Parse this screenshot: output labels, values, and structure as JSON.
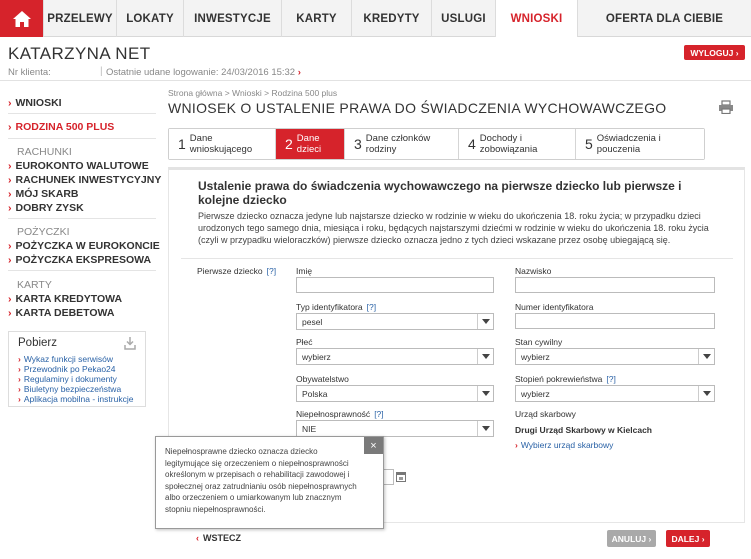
{
  "nav": {
    "items": [
      "PRZELEWY",
      "LOKATY",
      "INWESTYCJE",
      "KARTY",
      "KREDYTY",
      "USLUGI",
      "WNIOSKI",
      "OFERTA DLA CIEBIE"
    ],
    "active": "WNIOSKI"
  },
  "header": {
    "user_name": "KATARZYNA NET",
    "logout_label": "WYLOGUJ",
    "client_label": "Nr klienta:",
    "last_login": "Ostatnie udane logowanie: 24/03/2016 15:32"
  },
  "sidebar": {
    "wnioski": "WNIOSKI",
    "rodzina": "RODZINA 500 PLUS",
    "rachunki_head": "RACHUNKI",
    "rachunki": [
      "EUROKONTO WALUTOWE",
      "RACHUNEK INWESTYCYJNY",
      "MÓJ SKARB",
      "DOBRY ZYSK"
    ],
    "pozyczki_head": "POŻYCZKI",
    "pozyczki": [
      "POŻYCZKA W EUROKONCIE",
      "POŻYCZKA EKSPRESOWA"
    ],
    "karty_head": "KARTY",
    "karty": [
      "KARTA KREDYTOWA",
      "KARTA DEBETOWA"
    ],
    "pobierz_title": "Pobierz",
    "pobierz_links": [
      "Wykaz funkcji serwisów",
      "Przewodnik po Pekao24",
      "Regulaminy i dokumenty",
      "Biuletyny bezpieczeństwa",
      "Aplikacja mobilna - instrukcje"
    ]
  },
  "main": {
    "breadcrumb": "Strona główna > Wnioski > Rodzina 500 plus",
    "title": "WNIOSEK O USTALENIE PRAWA DO ŚWIADCZENIA WYCHOWAWCZEGO",
    "steps": [
      {
        "n": "1",
        "label": "Dane wnioskującego"
      },
      {
        "n": "2",
        "label": "Dane dzieci"
      },
      {
        "n": "3",
        "label": "Dane członków rodziny"
      },
      {
        "n": "4",
        "label": "Dochody i zobowiązania"
      },
      {
        "n": "5",
        "label": "Oświadczenia i pouczenia"
      }
    ],
    "active_step": 2
  },
  "form": {
    "title": "Ustalenie prawa do świadczenia wychowawczego na pierwsze dziecko lub pierwsze i kolejne dziecko",
    "description": "Pierwsze dziecko oznacza jedyne lub najstarsze dziecko w rodzinie w wieku do ukończenia 18. roku życia; w przypadku dzieci urodzonych tego samego dnia, miesiąca i roku, będących najstarszymi dziećmi w rodzinie w wieku do ukończenia 18. roku życia (czyli w przypadku wieloraczków) pierwsze dziecko oznacza jedno z tych dzieci wskazane przez osobę ubiegającą się.",
    "section_label": "Pierwsze dziecko",
    "help_mark": "[?]",
    "imie_label": "Imię",
    "nazwisko_label": "Nazwisko",
    "typ_label": "Typ identyfikatora",
    "typ_value": "pesel",
    "numer_label": "Numer identyfikatora",
    "plec_label": "Płeć",
    "plec_value": "wybierz",
    "stan_label": "Stan cywilny",
    "stan_value": "wybierz",
    "obyw_label": "Obywatelstwo",
    "obyw_value": "Polska",
    "stopien_label": "Stopień pokrewieństwa",
    "stopien_value": "wybierz",
    "niepel_label": "Niepełnosprawność",
    "niepel_value": "NIE",
    "urzad_label": "Urząd skarbowy",
    "urzad_name": "Drugi Urząd Skarbowy w Kielcach",
    "urzad_link": "Wybierz urząd skarbowy"
  },
  "tooltip": {
    "text": "Niepełnosprawne dziecko oznacza dziecko legitymujące się orzeczeniem o niepełnosprawności określonym w przepisach o rehabilitacji zawodowej i społecznej oraz zatrudnianiu osób niepełnosprawnych albo orzeczeniem o umiarkowanym lub znacznym stopniu niepełnosprawności.",
    "close": "×"
  },
  "footer": {
    "back_label": "WSTECZ",
    "cancel_label": "ANULUJ",
    "next_label": "DALEJ"
  },
  "colors": {
    "accent": "#d6232b",
    "link": "#2a62a6"
  }
}
